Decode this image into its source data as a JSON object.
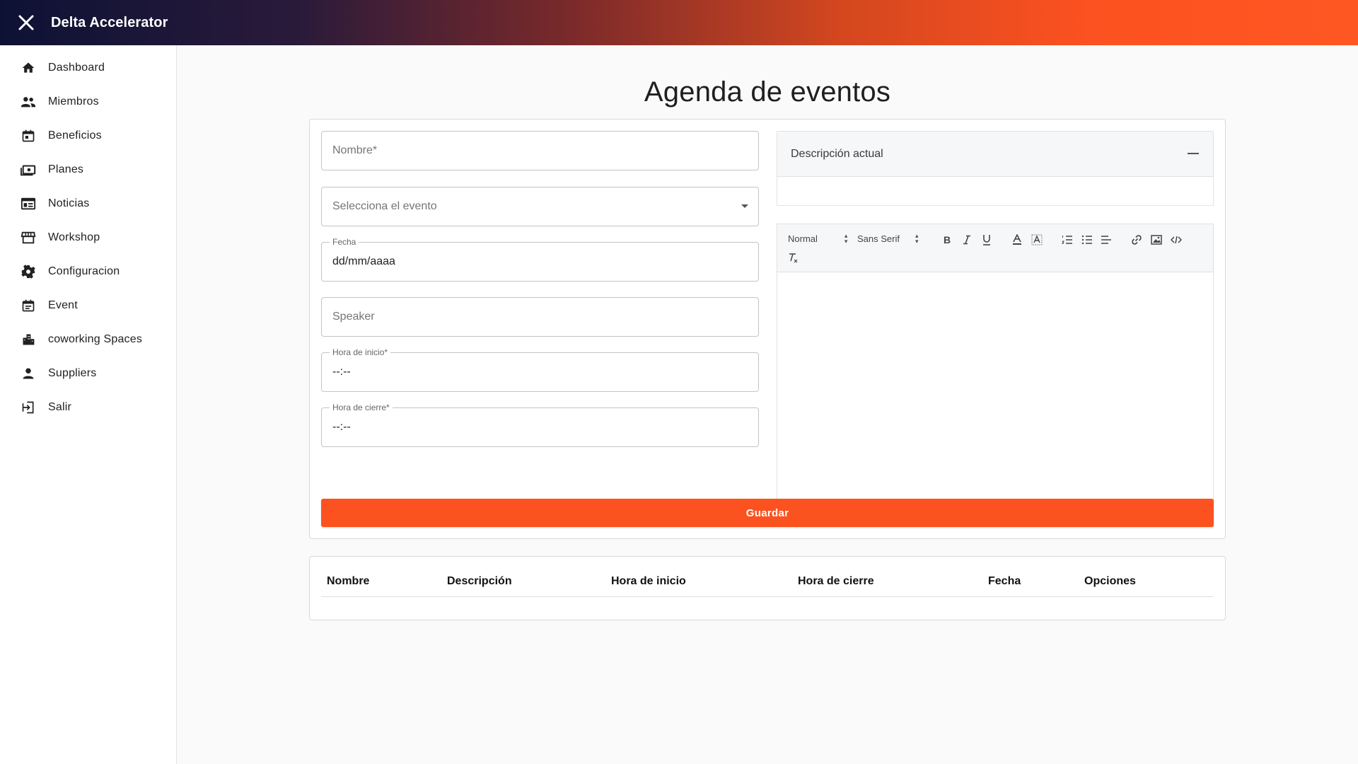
{
  "app": {
    "title": "Delta Accelerator"
  },
  "sidebar": {
    "items": [
      {
        "label": "Dashboard",
        "icon": "home-icon"
      },
      {
        "label": "Miembros",
        "icon": "people-icon"
      },
      {
        "label": "Beneficios",
        "icon": "calendar-icon"
      },
      {
        "label": "Planes",
        "icon": "payments-icon"
      },
      {
        "label": "Noticias",
        "icon": "news-icon"
      },
      {
        "label": "Workshop",
        "icon": "store-icon"
      },
      {
        "label": "Configuracion",
        "icon": "gear-icon"
      },
      {
        "label": "Event",
        "icon": "event-note-icon"
      },
      {
        "label": "coworking Spaces",
        "icon": "building-icon"
      },
      {
        "label": "Suppliers",
        "icon": "person-icon"
      },
      {
        "label": "Salir",
        "icon": "logout-icon"
      }
    ]
  },
  "page": {
    "title": "Agenda de eventos"
  },
  "form": {
    "nombre": {
      "placeholder": "Nombre*"
    },
    "evento": {
      "placeholder": "Selecciona el evento"
    },
    "fecha": {
      "label": "Fecha",
      "value": "dd/mm/aaaa"
    },
    "speaker": {
      "placeholder": "Speaker"
    },
    "hora_inicio": {
      "label": "Hora de inicio*",
      "value": "--:--"
    },
    "hora_cierre": {
      "label": "Hora de cierre*",
      "value": "--:--"
    },
    "save_label": "Guardar"
  },
  "description_panel": {
    "title": "Descripción actual"
  },
  "editor": {
    "header_select": "Normal",
    "font_select": "Sans Serif"
  },
  "table": {
    "headers": [
      "Nombre",
      "Descripción",
      "Hora de inicio",
      "Hora de cierre",
      "Fecha",
      "Opciones"
    ]
  },
  "colors": {
    "accent": "#fc521f",
    "appbar_start": "#0d1235",
    "appbar_end": "#ff5722"
  }
}
